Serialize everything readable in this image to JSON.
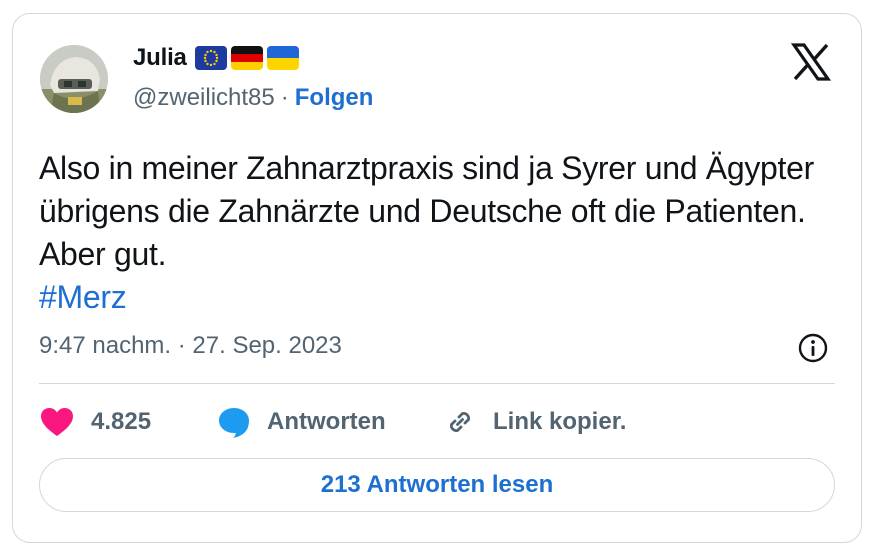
{
  "author": {
    "name": "Julia",
    "handle": "@zweilicht85",
    "separator": "·",
    "follow_label": "Folgen",
    "flags": [
      "eu-flag",
      "germany-flag",
      "ukraine-flag"
    ]
  },
  "tweet": {
    "text": "Also in meiner Zahnarztpraxis sind ja Syrer und Ägypter übrigens die Zahnärzte und Deutsche oft die Patienten. Aber gut.",
    "hashtag": "#Merz",
    "timestamp": "9:47 nachm. · 27. Sep. 2023"
  },
  "actions": {
    "likes_count": "4.825",
    "reply_label": "Antworten",
    "copy_link_label": "Link kopier."
  },
  "read_replies_label": "213 Antworten lesen",
  "icons": {
    "brand": "x-logo-icon",
    "info": "info-icon",
    "like": "heart-icon",
    "reply": "speech-bubble-icon",
    "link": "link-icon"
  },
  "colors": {
    "link_blue": "#1d6fd1",
    "heart": "#f91880",
    "reply_bubble": "#1d9bf0",
    "muted": "#536471",
    "border": "#cfd9de",
    "text": "#0f1419"
  }
}
